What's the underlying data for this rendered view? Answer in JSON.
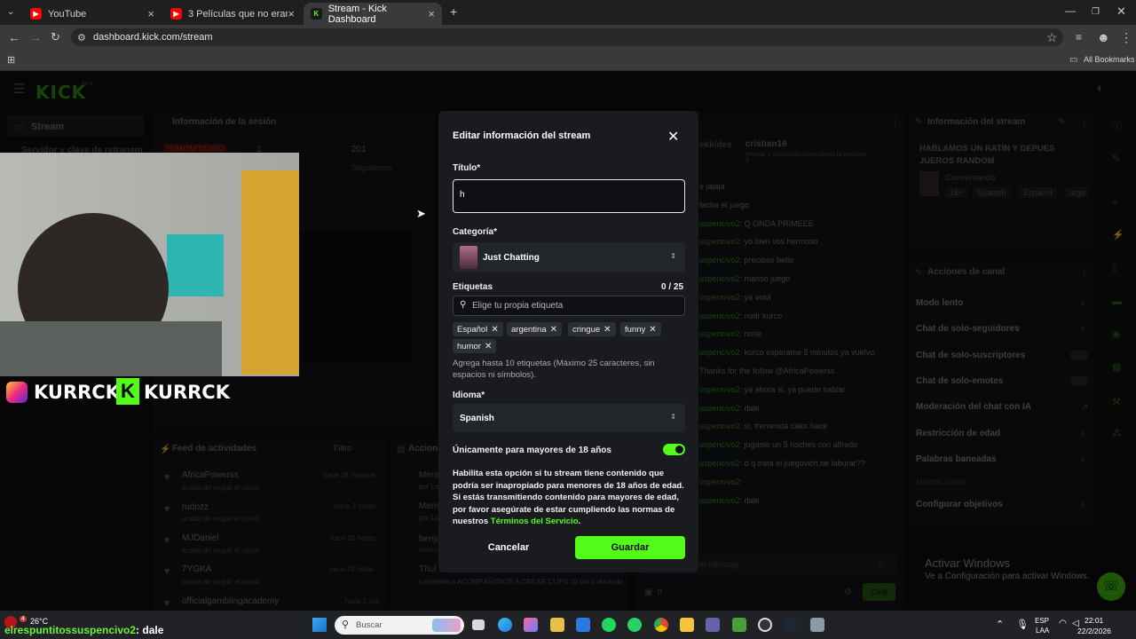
{
  "browser": {
    "tabs": [
      {
        "label": "YouTube",
        "icon": "youtube-icon"
      },
      {
        "label": "3 Películas que no eran exactan",
        "icon": "youtube-icon"
      },
      {
        "label": "Stream - Kick Dashboard",
        "icon": "kick-icon"
      }
    ],
    "url": "dashboard.kick.com/stream",
    "all_bookmarks": "All Bookmarks"
  },
  "kick": {
    "logo": "KICK",
    "beta": "BETA",
    "nav_stream": "Stream",
    "nav_server": "Servidor y clave de retransm",
    "session_title": "Información de la sesión",
    "live_badge": "TRANSMITIENDO",
    "stat_1": "1",
    "stat_201": "201",
    "stat_followers": "Seguidores",
    "activity_title": "Feed de actividades",
    "activity_filter": "Filtro",
    "actions_title": "Accion",
    "feed": [
      {
        "name": "AfricaPowerss",
        "sub": "acaba de seguir el canal",
        "time": "hace 19 minutos"
      },
      {
        "name": "rudozz",
        "sub": "acaba de seguir el canal",
        "time": "hace 2 horas"
      },
      {
        "name": "MJDaniel",
        "sub": "acaba de seguir el canal",
        "time": "hace 20 horas"
      },
      {
        "name": "7YGKA",
        "sub": "acaba de seguir el canal",
        "time": "hace 23 horas"
      },
      {
        "name": "officialgamblingacademy",
        "sub": "",
        "time": "hace 1 día"
      }
    ],
    "actions": [
      {
        "label": "Mens",
        "sub": "por Lo"
      },
      {
        "label": "Mens",
        "sub": "por Lo"
      },
      {
        "label": "benja",
        "sub": "elimina"
      },
      {
        "label": "Títul",
        "sub": "cambiado a ACOMPÁÑENOS A CREAR CLIPS :D por Lokuando"
      }
    ],
    "chat": {
      "header_user": "cristian16",
      "header_sub": "Regala 1 suscripción para tomar la posición 3",
      "header_left": "ekkides",
      "lines": [
        {
          "user": "",
          "text": "e jajaja"
        },
        {
          "user": "",
          "text": "facha el juego"
        },
        {
          "user": "uspencivo2:",
          "text": "Q ONDA PRIMEEE"
        },
        {
          "user": "uspencivo2:",
          "text": "yo bien vos hermoso"
        },
        {
          "user": "uspencivo2:",
          "text": "precioso bello"
        },
        {
          "user": "uspencivo2:",
          "text": "manso juego"
        },
        {
          "user": "uspencivo2:",
          "text": "ya volvi"
        },
        {
          "user": "uspencivo2:",
          "text": "nodr kurco"
        },
        {
          "user": "uspencivo2:",
          "text": "nose"
        },
        {
          "user": "uspencivo2:",
          "text": "kurco esperame 5 minutos ya vuelvo"
        },
        {
          "user": "",
          "text": "Thanks for the follow @AfricaPowerss"
        },
        {
          "user": "uspencivo2:",
          "text": "ya ahora si, ya puedo hablar"
        },
        {
          "user": "uspencivo2:",
          "text": "dale"
        },
        {
          "user": "uspencivo2:",
          "text": "si, tremenda calor hace"
        },
        {
          "user": "uspencivo2:",
          "text": "jugaste un 5 noches con alfredo"
        },
        {
          "user": "uspencivo2:",
          "text": "d q trata el juegovich,de laburar??"
        },
        {
          "user": "uspencivo2:",
          "text": ""
        },
        {
          "user": "uspencivo2:",
          "text": "dale"
        }
      ],
      "input_placeholder": "ar mensaje",
      "count": "0",
      "send": "Chat"
    },
    "stream_info": {
      "title": "Información del stream",
      "stream_title": "HABLAMOS UN RATIN Y DEPUES JUEROS RANDOM",
      "category": "Conversando",
      "tags": [
        "18+",
        "Spanish",
        "Español",
        "arge"
      ]
    },
    "channel_actions": {
      "title": "Acciones de canal",
      "items": [
        "Modo lento",
        "Chat de solo-seguidores",
        "Chat de solo-suscriptores",
        "Chat de solo-emotes",
        "Moderación del chat con IA",
        "Restricción de edad",
        "Palabras baneadas",
        "Mostrar canal",
        "Configurar objetivos"
      ]
    },
    "activate_windows": {
      "title": "Activar Windows",
      "sub": "Ve a Configuración para activar Windows."
    }
  },
  "webcam": {
    "handle1": "KURRCK",
    "handle2": "KURRCK",
    "chat_overlay_user": "elrespuntitossuspencivo2",
    "chat_overlay_text": ": dale"
  },
  "modal": {
    "title": "Editar información del stream",
    "titulo_label": "Título*",
    "titulo_value": "h",
    "categoria_label": "Categoría*",
    "categoria_value": "Just Chatting",
    "etiquetas_label": "Etiquetas",
    "etiquetas_count": "0 / 25",
    "etiquetas_placeholder": "Elige tu propia etiqueta",
    "tags": [
      "Español",
      "argentina",
      "cringue",
      "funny",
      "humor"
    ],
    "tags_help_1": "Agrega hasta 10 etiquetas (Máximo 25 caracteres, sin",
    "tags_help_2": "espacios ni símbolos).",
    "idioma_label": "Idioma*",
    "idioma_value": "Spanish",
    "adult_label": "Únicamente para mayores de 18 años",
    "adult_enabled": true,
    "warning_1": "Habilita esta opción si tu stream tiene contenido que",
    "warning_2": "podría ser inapropiado para menores de 18 años de edad.",
    "warning_3": "Si estás transmitiendo contenido para mayores de edad,",
    "warning_4": "por favor asegúrate de estar cumpliendo las normas de",
    "warning_5": "nuestros",
    "warning_link": "Términos del Servicio",
    "cancel": "Cancelar",
    "save": "Guardar"
  },
  "taskbar": {
    "weather": "26°C",
    "weather_badge": "4",
    "search_placeholder": "Buscar",
    "lang_1": "ESP",
    "lang_2": "LAA",
    "time": "22:01",
    "date": "22/2/2026"
  },
  "colors": {
    "accent": "#53fc18",
    "modal_bg": "#191b1f",
    "page_bg": "#0e0f10"
  }
}
